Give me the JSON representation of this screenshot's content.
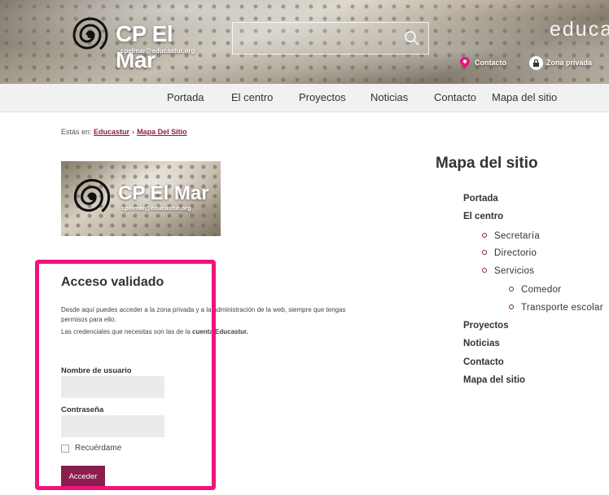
{
  "header": {
    "logo_title": "CP El Mar",
    "logo_email": "cpelmar@educastur.org",
    "search": {
      "value": "",
      "placeholder": ""
    },
    "brand_text": "educa",
    "links": {
      "contact": "Contacto",
      "private": "Zona privada"
    }
  },
  "nav": {
    "items": [
      "Portada",
      "El centro",
      "Proyectos",
      "Noticias",
      "Contacto",
      "Mapa del sitio"
    ]
  },
  "breadcrumb": {
    "prefix": "Estás en:",
    "items": [
      "Educastur",
      "Mapa Del Sitio"
    ],
    "separator": "›"
  },
  "side_logo": {
    "title": "CP El Mar",
    "email": "cpelmar@educastur.org"
  },
  "login": {
    "title": "Acceso validado",
    "desc_1": "Desde aquí puedes acceder a la zona privada y a la administración de la web, siempre que tengas permisos para ello.",
    "desc_2_start": "Las credenciales que necesitas son las de la ",
    "desc_2_bold": "cuenta Educastur.",
    "username_label": "Nombre de usuario",
    "password_label": "Contraseña",
    "remember_label": "Recuérdame",
    "submit_label": "Acceder",
    "accent_color": "#8a1d4e",
    "highlight_color": "#f0147a"
  },
  "sitemap": {
    "title": "Mapa del sitio",
    "items": {
      "portada": "Portada",
      "centro": "El centro",
      "secretaria": "Secretaría",
      "directorio": "Directorio",
      "servicios": "Servicios",
      "comedor": "Comedor",
      "transporte": "Transporte escolar",
      "proyectos": "Proyectos",
      "noticias": "Noticias",
      "contacto": "Contacto",
      "mapa": "Mapa del sitio"
    }
  }
}
